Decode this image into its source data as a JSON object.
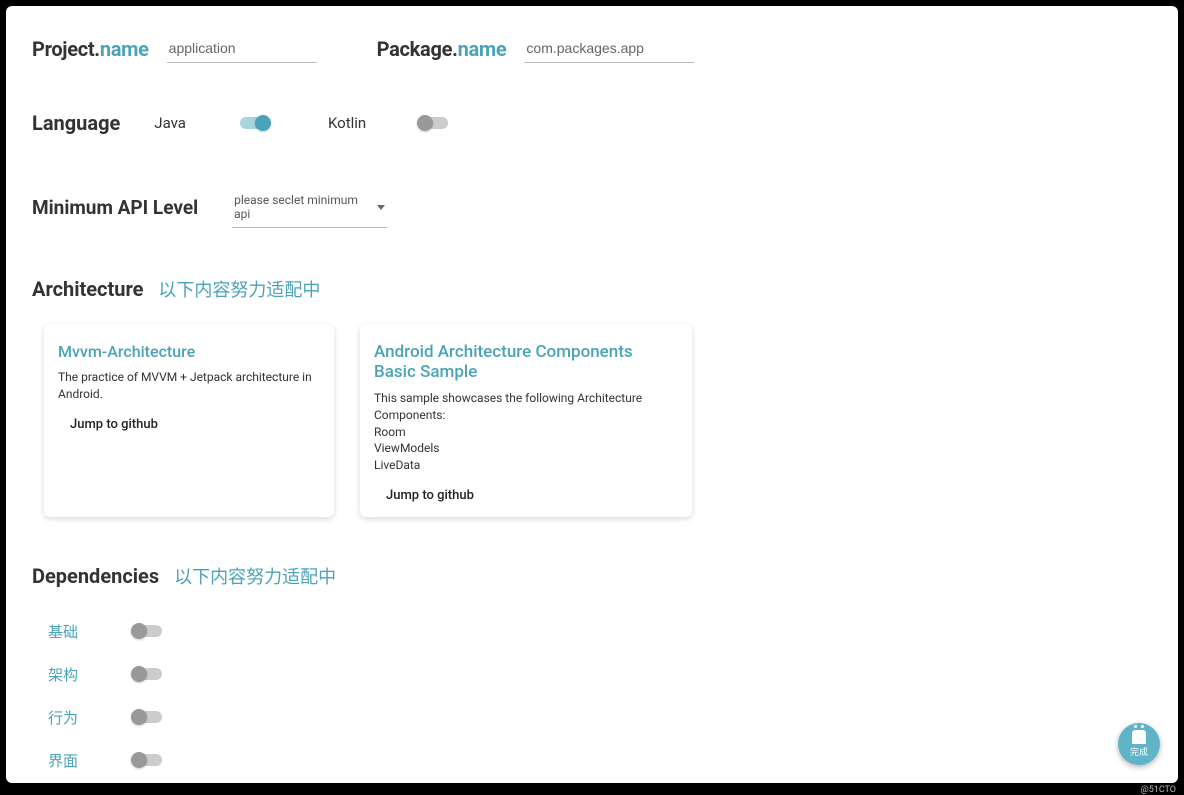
{
  "project": {
    "label_prefix": "Project.",
    "label_accent": "name",
    "value": "application"
  },
  "package": {
    "label_prefix": "Package.",
    "label_accent": "name",
    "value": "com.packages.app"
  },
  "language": {
    "label": "Language",
    "options": [
      {
        "name": "Java",
        "enabled": true
      },
      {
        "name": "Kotlin",
        "enabled": false
      }
    ]
  },
  "api": {
    "label": "Minimum API Level",
    "placeholder": "please seclet minimum api"
  },
  "architecture": {
    "title": "Architecture",
    "subtitle": "以下内容努力适配中",
    "cards": [
      {
        "title": "Mvvm-Architecture",
        "desc": "The practice of MVVM + Jetpack architecture in Android.",
        "action": "Jump to github"
      },
      {
        "title": "Android Architecture Components Basic Sample",
        "desc": "This sample showcases the following Architecture Components:\nRoom\nViewModels\nLiveData",
        "action": "Jump to github"
      }
    ]
  },
  "dependencies": {
    "title": "Dependencies",
    "subtitle": "以下内容努力适配中",
    "items": [
      {
        "label": "基础",
        "enabled": false
      },
      {
        "label": "架构",
        "enabled": false
      },
      {
        "label": "行为",
        "enabled": false
      },
      {
        "label": "界面",
        "enabled": false
      }
    ]
  },
  "fab": {
    "text": "完成"
  },
  "watermark": "@51CTO"
}
